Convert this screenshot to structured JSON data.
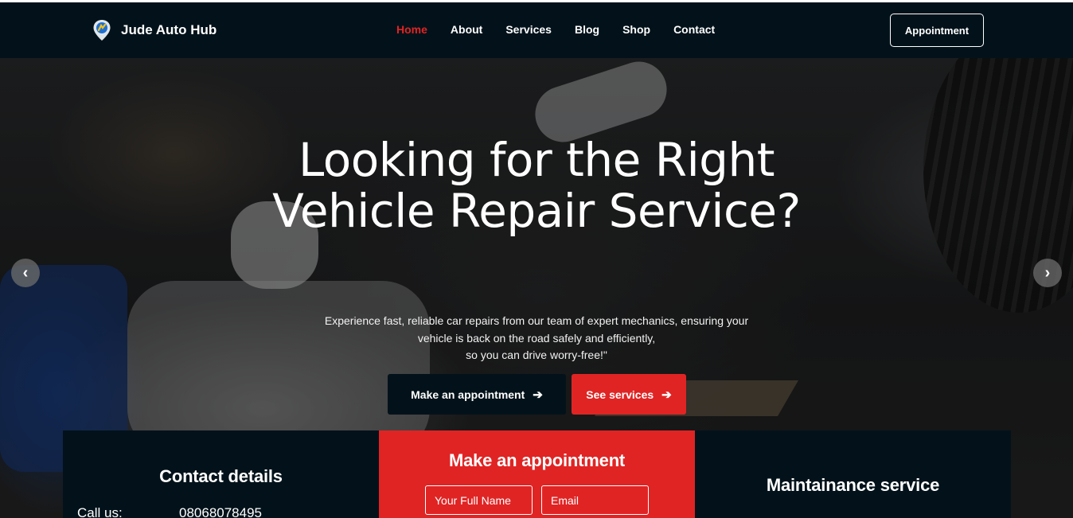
{
  "brand": {
    "name": "Jude Auto Hub",
    "logo_icon": "map-pin-logo-icon"
  },
  "nav": {
    "items": [
      {
        "label": "Home",
        "active": true
      },
      {
        "label": "About",
        "active": false
      },
      {
        "label": "Services",
        "active": false
      },
      {
        "label": "Blog",
        "active": false
      },
      {
        "label": "Shop",
        "active": false
      },
      {
        "label": "Contact",
        "active": false
      }
    ],
    "cta_label": "Appointment"
  },
  "hero": {
    "title": "Looking for the Right Vehicle Repair Service?",
    "description_lines": [
      "Experience fast, reliable car repairs from our team of expert mechanics, ensuring your",
      "vehicle is back on the road safely and efficiently,",
      "so you can drive worry-free!\""
    ],
    "primary_button": "Make an appointment",
    "secondary_button": "See services",
    "prev_icon": "chevron-left-icon",
    "next_icon": "chevron-right-icon"
  },
  "contact_card": {
    "title": "Contact details",
    "call_label": "Call us:",
    "call_value": "08068078495"
  },
  "appointment_card": {
    "title": "Make an appointment",
    "name_placeholder": "Your Full Name",
    "email_placeholder": "Email"
  },
  "maintenance_card": {
    "title": "Maintainance service"
  },
  "colors": {
    "navy": "#03121a",
    "accent_red": "#e02424",
    "white": "#ffffff"
  }
}
